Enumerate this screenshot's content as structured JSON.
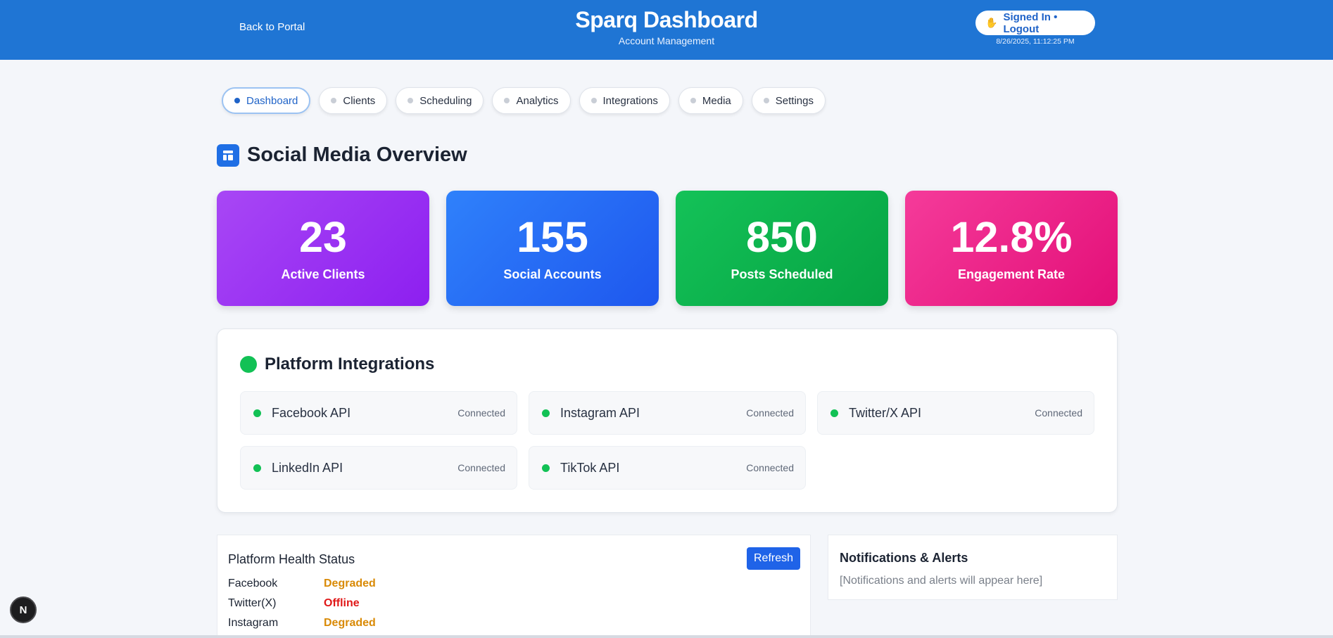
{
  "header": {
    "back_label": "Back to Portal",
    "title": "Sparq Dashboard",
    "subtitle": "Account Management",
    "signin_icon": "waving-hand-icon",
    "signin_label": "Signed In • Logout",
    "timestamp": "8/26/2025, 11:12:25 PM",
    "brand_color": "#1f75d4"
  },
  "tabs": [
    {
      "label": "Dashboard",
      "active": true
    },
    {
      "label": "Clients"
    },
    {
      "label": "Scheduling"
    },
    {
      "label": "Analytics"
    },
    {
      "label": "Integrations"
    },
    {
      "label": "Media"
    },
    {
      "label": "Settings"
    }
  ],
  "overview": {
    "title": "Social Media Overview",
    "icon": "dashboard-layout-icon"
  },
  "stats": [
    {
      "value": "23",
      "label": "Active Clients",
      "color": "#9b32f3"
    },
    {
      "value": "155",
      "label": "Social Accounts",
      "color": "#2768f4"
    },
    {
      "value": "850",
      "label": "Posts Scheduled",
      "color": "#0cb24e"
    },
    {
      "value": "12.8%",
      "label": "Engagement Rate",
      "color": "#ee2489"
    }
  ],
  "integrations": {
    "title": "Platform Integrations",
    "items": [
      {
        "name": "Facebook API",
        "status": "Connected"
      },
      {
        "name": "Instagram API",
        "status": "Connected"
      },
      {
        "name": "Twitter/X API",
        "status": "Connected"
      },
      {
        "name": "LinkedIn API",
        "status": "Connected"
      },
      {
        "name": "TikTok API",
        "status": "Connected"
      }
    ]
  },
  "health": {
    "title": "Platform Health Status",
    "refresh_label": "Refresh",
    "rows": [
      {
        "platform": "Facebook",
        "status": "Degraded",
        "color": "#d98a06"
      },
      {
        "platform": "Twitter(X)",
        "status": "Offline",
        "color": "#e01818"
      },
      {
        "platform": "Instagram",
        "status": "Degraded",
        "color": "#d98a06"
      }
    ]
  },
  "notifications": {
    "title": "Notifications & Alerts",
    "empty_text": "[Notifications and alerts will appear here]"
  },
  "dev_badge": {
    "label": "N"
  }
}
